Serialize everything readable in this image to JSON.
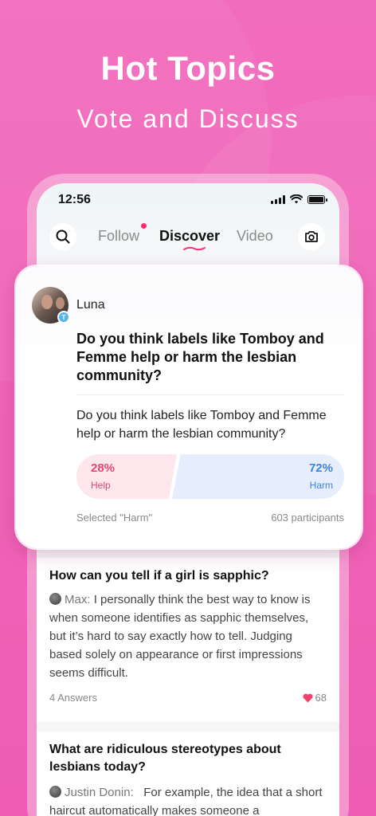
{
  "hero": {
    "title": "Hot Topics",
    "subtitle": "Vote and Discuss"
  },
  "status_bar": {
    "time": "12:56"
  },
  "nav": {
    "tabs": [
      {
        "label": "Follow",
        "active": false,
        "has_notification": true
      },
      {
        "label": "Discover",
        "active": true
      },
      {
        "label": "Video",
        "active": false
      }
    ],
    "left_icon": "search-icon",
    "right_icon": "camera-icon"
  },
  "poll_card": {
    "author": "Luna",
    "avatar_badge": "T",
    "title": "Do you think labels like Tomboy and Femme help or harm the lesbian community?",
    "question": "Do you think labels like Tomboy and Femme help or harm the lesbian community?",
    "options": [
      {
        "label": "Help",
        "percent": "28%",
        "share": 0.28,
        "color": "#e8456f"
      },
      {
        "label": "Harm",
        "percent": "72%",
        "share": 0.72,
        "color": "#3b83e0"
      }
    ],
    "selected": "Selected \"Harm\"",
    "participants": "603 participants"
  },
  "feed": [
    {
      "title": "How can you tell if a girl is sapphic?",
      "author": "Max:",
      "excerpt": "I personally think the best way to know is when someone identifies as sapphic themselves, but it’s hard to say exactly how to tell. Judging based solely on appearance or first impressions seems difficult.",
      "answers": "4 Answers",
      "likes": "68"
    },
    {
      "title": "What are ridiculous stereotypes about lesbians today?",
      "author": "Justin Donin:",
      "excerpt": "For example, the idea that a short haircut automatically makes someone a"
    }
  ],
  "colors": {
    "background": "#f062b8",
    "accent": "#ff2d6e",
    "harm": "#3b83e0",
    "help": "#e8456f"
  }
}
